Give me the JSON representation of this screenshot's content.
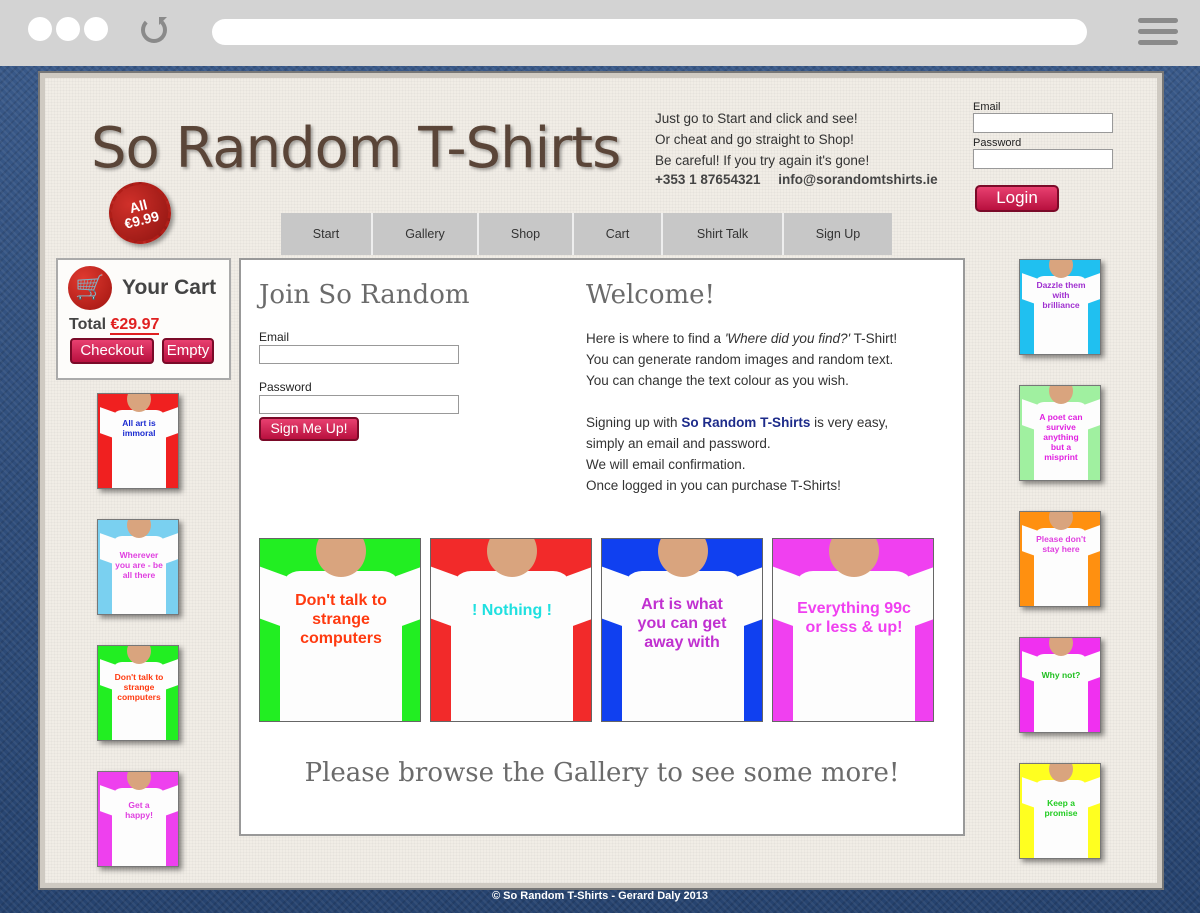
{
  "header": {
    "logo": "So Random T-Shirts",
    "tagline": [
      "Just go to Start and click and see!",
      "Or cheat and go straight to Shop!",
      "Be careful! If you try again it's gone!"
    ],
    "phone": "+353 1 87654321",
    "email": "info@sorandomtshirts.ie",
    "badge_line1": "All",
    "badge_line2": "€9.99"
  },
  "login": {
    "email_label": "Email",
    "password_label": "Password",
    "button": "Login"
  },
  "nav": {
    "items": [
      "Start",
      "Gallery",
      "Shop",
      "Cart",
      "Shirt Talk",
      "Sign Up"
    ]
  },
  "cart": {
    "title": "Your Cart",
    "total_label": "Total",
    "total_value": "€29.97",
    "checkout": "Checkout",
    "empty": "Empty"
  },
  "left_shirts": [
    {
      "text": "All art is immoral",
      "bg": "#f02020",
      "color": "#1a2ad0"
    },
    {
      "text": "Wherever you are - be all there",
      "bg": "#7ad0f0",
      "color": "#e040e0"
    },
    {
      "text": "Don't talk to strange computers",
      "bg": "#22ee22",
      "color": "#ff3a10"
    },
    {
      "text": "Get a happy!",
      "bg": "#ee40ee",
      "color": "#e040e0"
    }
  ],
  "right_shirts": [
    {
      "text": "Dazzle them with brilliance",
      "bg": "#20c0f0",
      "color": "#a030d0"
    },
    {
      "text": "A poet can survive anything but a misprint",
      "bg": "#a0f0a0",
      "color": "#e020e0"
    },
    {
      "text": "Please don't stay here",
      "bg": "#ff9010",
      "color": "#e040e0"
    },
    {
      "text": "Why not?",
      "bg": "#f030f0",
      "color": "#20c020"
    },
    {
      "text": "Keep a promise",
      "bg": "#ffff20",
      "color": "#22cc22"
    }
  ],
  "join": {
    "title": "Join So Random",
    "email_label": "Email",
    "password_label": "Password",
    "button": "Sign Me Up!"
  },
  "welcome": {
    "title": "Welcome!",
    "line1_pre": "Here is where to find a ",
    "line1_em": "'Where did you find?'",
    "line1_post": " T-Shirt!",
    "line2": "You can generate random images and random text.",
    "line3": "You can change the text colour as you wish.",
    "line4_pre": "Signing up with ",
    "line4_brand": "So Random T-Shirts",
    "line4_post": " is very easy,",
    "line5": "simply an email and password.",
    "line6": "We will email confirmation.",
    "line7": "Once logged in you can purchase T-Shirts!"
  },
  "featured": [
    {
      "text": "Don't talk to strange computers",
      "bg": "#22ee22",
      "color": "#ff3a10"
    },
    {
      "text": "! Nothing !",
      "bg": "#f22a2a",
      "color": "#20e0e0"
    },
    {
      "text": "Art is what you can get away with",
      "bg": "#1040f0",
      "color": "#c030d0"
    },
    {
      "text": "Everything 99c or less & up!",
      "bg": "#f040f0",
      "color": "#f040f0"
    }
  ],
  "browse": "Please browse the Gallery to see some more!",
  "footer": "© So Random T-Shirts - Gerard Daly 2013"
}
